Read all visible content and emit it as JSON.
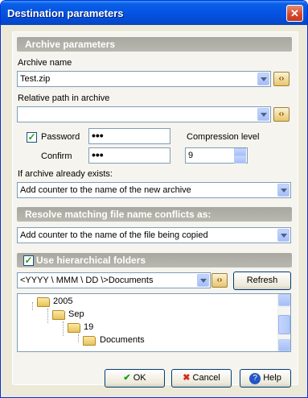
{
  "window": {
    "title": "Destination parameters",
    "close_glyph": "✕"
  },
  "archive": {
    "header": "Archive parameters",
    "name_label": "Archive name",
    "name_value": "Test.zip",
    "path_label": "Relative path in archive",
    "path_value": "",
    "password_label": "Password",
    "password_value": "•••",
    "password_checked": true,
    "confirm_label": "Confirm",
    "confirm_value": "•••",
    "compression_label": "Compression level",
    "compression_value": "9",
    "exists_label": "If archive already exists:",
    "exists_value": "Add counter to the name of the new archive"
  },
  "conflicts": {
    "header": "Resolve matching file name conflicts as:",
    "value": "Add counter to the name of the file being copied"
  },
  "folders": {
    "header": "Use hierarchical folders",
    "checked": true,
    "template_value": "<YYYY \\ MMM \\ DD \\>Documents",
    "refresh_label": "Refresh",
    "tree": [
      {
        "label": "2005",
        "level": 0
      },
      {
        "label": "Sep",
        "level": 1
      },
      {
        "label": "19",
        "level": 2
      },
      {
        "label": "Documents",
        "level": 3
      }
    ]
  },
  "buttons": {
    "ok": "OK",
    "cancel": "Cancel",
    "help": "Help"
  },
  "icons": {
    "ok": "check-icon",
    "cancel": "cross-icon",
    "help": "question-icon",
    "macro": "macro-icon",
    "folder": "folder-icon"
  },
  "colors": {
    "titlebar": "#0554e3",
    "header": "#b0afa7",
    "dialog_bg": "#ece9d8"
  }
}
